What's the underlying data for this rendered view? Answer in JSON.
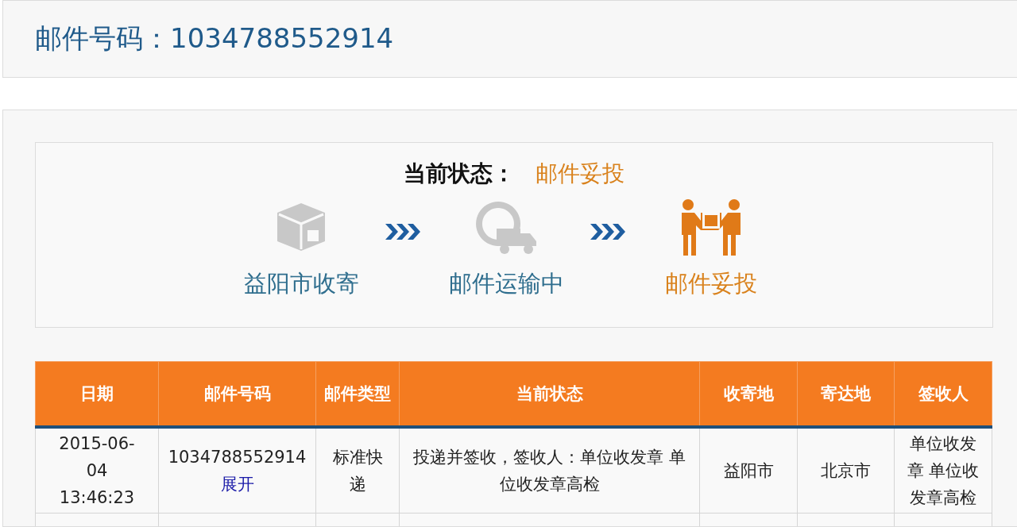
{
  "header": {
    "label": "邮件号码：",
    "number": "1034788552914"
  },
  "status": {
    "label": "当前状态：",
    "value": "邮件妥投",
    "steps": [
      {
        "kind": "box",
        "label": "益阳市收寄",
        "selected": false
      },
      {
        "kind": "truck",
        "label": "邮件运输中",
        "selected": false
      },
      {
        "kind": "handover",
        "label": "邮件妥投",
        "selected": true
      }
    ]
  },
  "table": {
    "columns": [
      "日期",
      "邮件号码",
      "邮件类型",
      "当前状态",
      "收寄地",
      "寄达地",
      "签收人"
    ],
    "rows": [
      {
        "date": "2015-06-04 13:46:23",
        "number": "1034788552914",
        "expand": "展开",
        "type": "标准快递",
        "status": "投递并签收，签收人：单位收发章 单位收发章高检",
        "origin": "益阳市",
        "destination": "北京市",
        "signer": "单位收发章 单位收发章高检"
      }
    ]
  }
}
